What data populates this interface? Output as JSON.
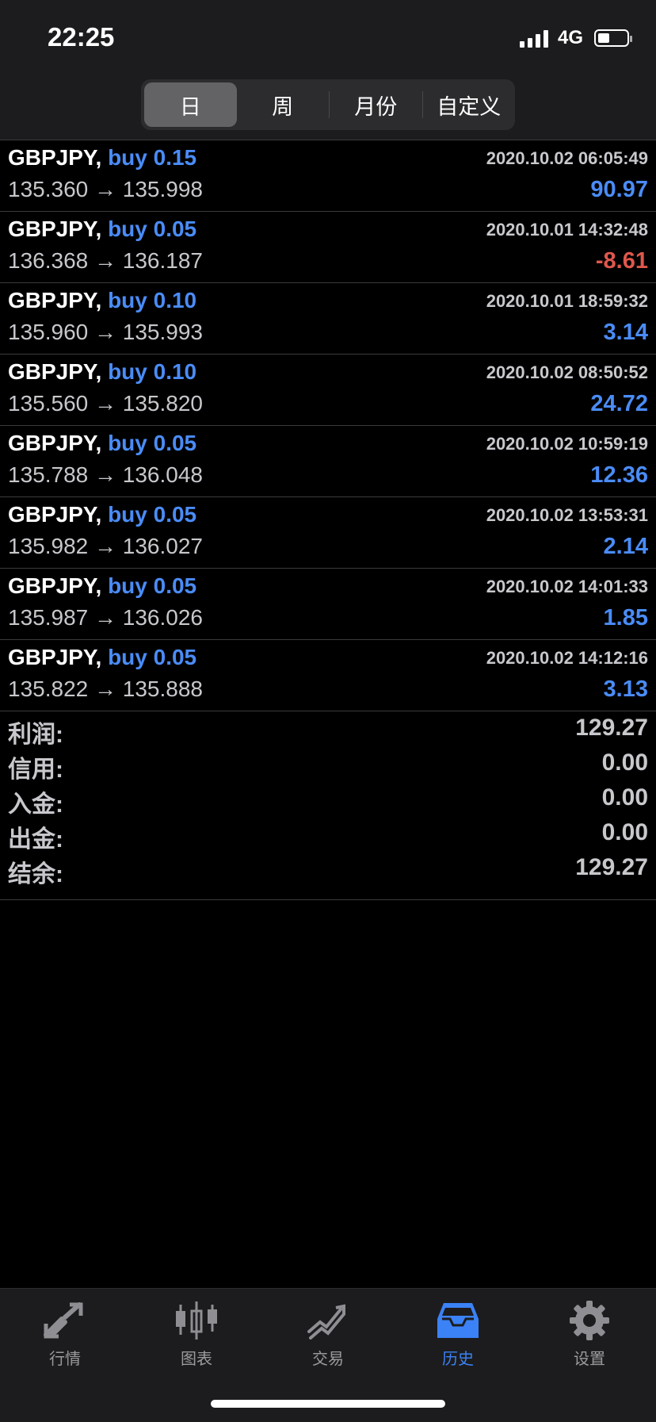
{
  "status": {
    "time": "22:25",
    "network": "4G"
  },
  "tabs": [
    {
      "label": "日",
      "active": true
    },
    {
      "label": "周",
      "active": false
    },
    {
      "label": "月份",
      "active": false
    },
    {
      "label": "自定义",
      "active": false
    }
  ],
  "trades": [
    {
      "symbol": "GBPJPY,",
      "side": "buy 0.15",
      "time": "2020.10.02 06:05:49",
      "prices": "135.360 → 135.998",
      "profit": "90.97"
    },
    {
      "symbol": "GBPJPY,",
      "side": "buy 0.05",
      "time": "2020.10.01 14:32:48",
      "prices": "136.368 → 136.187",
      "profit": "-8.61"
    },
    {
      "symbol": "GBPJPY,",
      "side": "buy 0.10",
      "time": "2020.10.01 18:59:32",
      "prices": "135.960 → 135.993",
      "profit": "3.14"
    },
    {
      "symbol": "GBPJPY,",
      "side": "buy 0.10",
      "time": "2020.10.02 08:50:52",
      "prices": "135.560 → 135.820",
      "profit": "24.72"
    },
    {
      "symbol": "GBPJPY,",
      "side": "buy 0.05",
      "time": "2020.10.02 10:59:19",
      "prices": "135.788 → 136.048",
      "profit": "12.36"
    },
    {
      "symbol": "GBPJPY,",
      "side": "buy 0.05",
      "time": "2020.10.02 13:53:31",
      "prices": "135.982 → 136.027",
      "profit": "2.14"
    },
    {
      "symbol": "GBPJPY,",
      "side": "buy 0.05",
      "time": "2020.10.02 14:01:33",
      "prices": "135.987 → 136.026",
      "profit": "1.85"
    },
    {
      "symbol": "GBPJPY,",
      "side": "buy 0.05",
      "time": "2020.10.02 14:12:16",
      "prices": "135.822 → 135.888",
      "profit": "3.13"
    }
  ],
  "summary": [
    {
      "label": "利润:",
      "value": "129.27"
    },
    {
      "label": "信用:",
      "value": "0.00"
    },
    {
      "label": "入金:",
      "value": "0.00"
    },
    {
      "label": "出金:",
      "value": "0.00"
    },
    {
      "label": "结余:",
      "value": "129.27"
    }
  ],
  "tabbar": [
    {
      "label": "行情",
      "icon": "quotes-icon",
      "active": false
    },
    {
      "label": "图表",
      "icon": "chart-candles-icon",
      "active": false
    },
    {
      "label": "交易",
      "icon": "trade-icon",
      "active": false
    },
    {
      "label": "历史",
      "icon": "history-inbox-icon",
      "active": true
    },
    {
      "label": "设置",
      "icon": "gear-icon",
      "active": false
    }
  ],
  "colors": {
    "accent": "#4a8cf7",
    "negative": "#e0574c",
    "tab_active": "#3b82f6"
  }
}
